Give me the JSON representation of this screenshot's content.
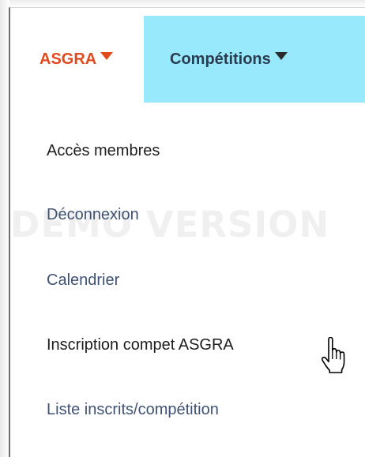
{
  "menubar": {
    "asgra_label": "ASGRA",
    "asgra_color": "#e14a1d",
    "competitions_label": "Compétitions",
    "competitions_bg": "#97e9fb"
  },
  "dropdown": {
    "items": [
      {
        "label": "Accès membres"
      },
      {
        "label": "Déconnexion"
      },
      {
        "label": "Calendrier"
      },
      {
        "label": "Inscription compet ASGRA"
      },
      {
        "label": "Liste inscrits/compétition"
      }
    ]
  },
  "watermark": "DEMO VERSION",
  "icons": {
    "asgra_caret": "caret-down-icon",
    "competitions_caret": "caret-down-icon",
    "cursor": "hand-pointer-icon"
  }
}
